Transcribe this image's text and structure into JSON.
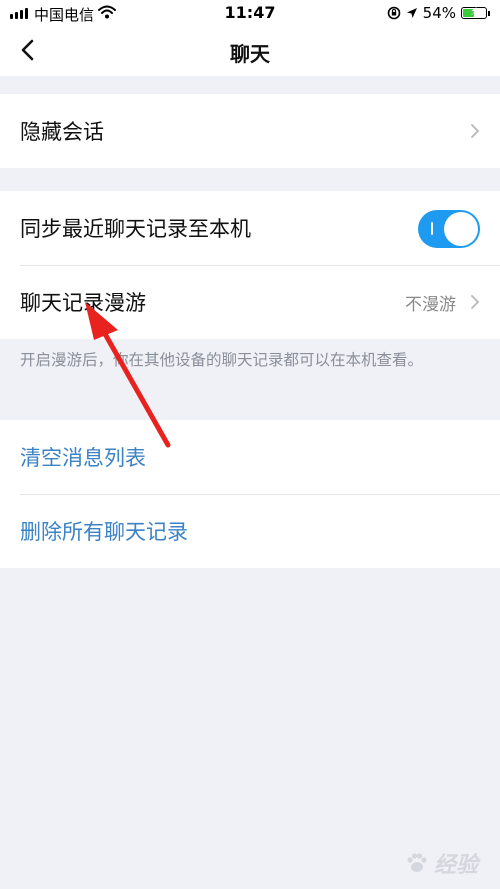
{
  "status_bar": {
    "carrier": "中国电信",
    "time": "11:47",
    "battery_percent": "54%",
    "battery_level": 0.54,
    "icons": [
      "signal-icon",
      "wifi-icon",
      "location-icon",
      "orientation-lock-icon",
      "battery-icon"
    ]
  },
  "nav": {
    "title": "聊天",
    "back_icon": "chevron-left-icon"
  },
  "sections": {
    "hidden": {
      "label": "隐藏会话"
    },
    "sync": {
      "label": "同步最近聊天记录至本机",
      "toggle_on": true
    },
    "roaming": {
      "label": "聊天记录漫游",
      "value": "不漫游"
    },
    "hint": "开启漫游后，你在其他设备的聊天记录都可以在本机查看。",
    "clear": {
      "label": "清空消息列表"
    },
    "delete": {
      "label": "删除所有聊天记录"
    }
  },
  "colors": {
    "accent": "#1e9bf0",
    "link": "#3b82c6",
    "background": "#eff1f7",
    "annotation_arrow": "#e8231f"
  },
  "watermark": {
    "text": "经验",
    "logo": "baidu-paw-logo"
  }
}
